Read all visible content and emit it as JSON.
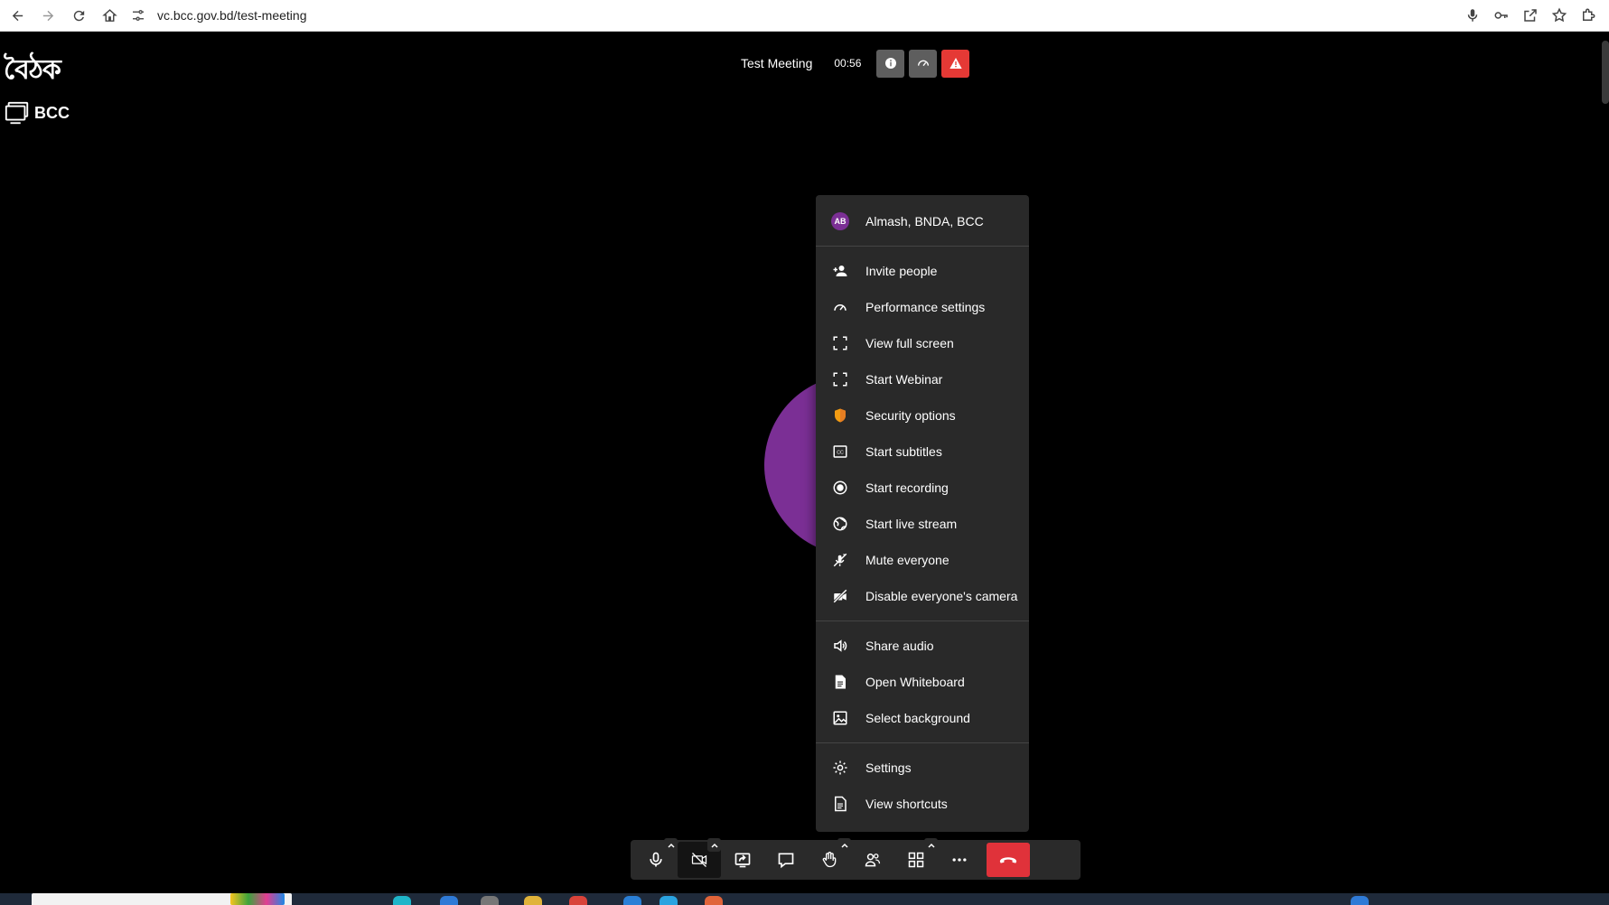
{
  "browser": {
    "url": "vc.bcc.gov.bd/test-meeting"
  },
  "logo": {
    "bangla": "বৈঠক",
    "org": "BCC"
  },
  "meeting": {
    "title": "Test Meeting",
    "timer": "00:56"
  },
  "avatar": {
    "initial": "A",
    "color": "#7b2f95"
  },
  "menu": {
    "user": {
      "initials": "AB",
      "name": "Almash, BNDA, BCC"
    },
    "items": [
      {
        "label": "Invite people",
        "icon": "add-person-icon"
      },
      {
        "label": "Performance settings",
        "icon": "gauge-icon"
      },
      {
        "label": "View full screen",
        "icon": "fullscreen-icon"
      },
      {
        "label": "Start Webinar",
        "icon": "fullscreen-icon"
      },
      {
        "label": "Security options",
        "icon": "shield-icon"
      },
      {
        "label": "Start subtitles",
        "icon": "closed-captions-icon"
      },
      {
        "label": "Start recording",
        "icon": "record-icon"
      },
      {
        "label": "Start live stream",
        "icon": "globe-icon"
      },
      {
        "label": "Mute everyone",
        "icon": "mute-everyone-icon"
      },
      {
        "label": "Disable everyone's camera",
        "icon": "camera-off-icon"
      }
    ],
    "items2": [
      {
        "label": "Share audio",
        "icon": "speaker-icon"
      },
      {
        "label": "Open Whiteboard",
        "icon": "document-icon"
      },
      {
        "label": "Select background",
        "icon": "image-icon"
      }
    ],
    "items3": [
      {
        "label": "Settings",
        "icon": "gear-icon"
      },
      {
        "label": "View shortcuts",
        "icon": "document-icon"
      }
    ]
  },
  "toolbar": {
    "buttons": [
      "microphone-icon",
      "camera-off-icon",
      "share-screen-icon",
      "chat-icon",
      "raise-hand-icon",
      "participants-icon",
      "tile-view-icon",
      "more-icon",
      "hangup-icon"
    ]
  },
  "colors": {
    "accent_red": "#e0323a",
    "menu_bg": "#292929",
    "avatar_purple": "#7b2f95",
    "shield_orange": "#f39c12"
  }
}
